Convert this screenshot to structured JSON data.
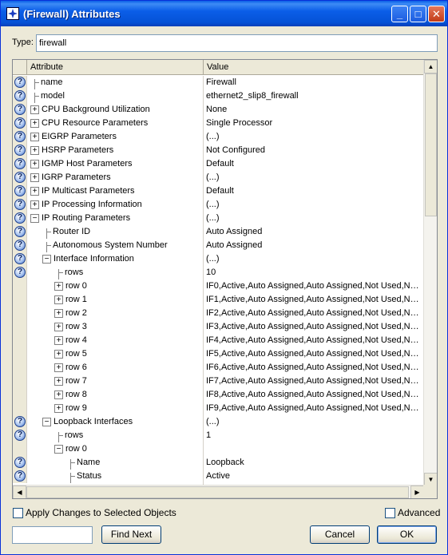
{
  "window": {
    "title": "(Firewall) Attributes"
  },
  "type_field": {
    "label": "Type:",
    "value": "firewall"
  },
  "grid": {
    "headers": {
      "attribute": "Attribute",
      "value": "Value"
    },
    "rows": [
      {
        "label": "name",
        "value": "Firewall",
        "help": true
      },
      {
        "label": "model",
        "value": "ethernet2_slip8_firewall",
        "help": true
      },
      {
        "label": "CPU Background Utilization",
        "value": "None",
        "help": true,
        "expander": "+"
      },
      {
        "label": "CPU Resource Parameters",
        "value": "Single Processor",
        "help": true,
        "expander": "+"
      },
      {
        "label": "EIGRP Parameters",
        "value": "(...)",
        "help": true,
        "expander": "+"
      },
      {
        "label": "HSRP Parameters",
        "value": "Not Configured",
        "help": true,
        "expander": "+"
      },
      {
        "label": "IGMP Host Parameters",
        "value": "Default",
        "help": true,
        "expander": "+"
      },
      {
        "label": "IGRP Parameters",
        "value": "(...)",
        "help": true,
        "expander": "+"
      },
      {
        "label": "IP Multicast Parameters",
        "value": "Default",
        "help": true,
        "expander": "+"
      },
      {
        "label": "IP Processing Information",
        "value": "(...)",
        "help": true,
        "expander": "+"
      },
      {
        "label": "IP Routing Parameters",
        "value": "(...)",
        "help": true,
        "expander": "−"
      },
      {
        "label": "Router ID",
        "value": "Auto Assigned",
        "help": true
      },
      {
        "label": "Autonomous System Number",
        "value": "Auto Assigned",
        "help": true
      },
      {
        "label": "Interface Information",
        "value": "(...)",
        "help": true,
        "expander": "−"
      },
      {
        "label": "rows",
        "value": "10",
        "help": true
      },
      {
        "label": "row 0",
        "value": "IF0,Active,Auto Assigned,Auto Assigned,Not Used,Non...",
        "help": false,
        "expander": "+"
      },
      {
        "label": "row 1",
        "value": "IF1,Active,Auto Assigned,Auto Assigned,Not Used,Non...",
        "help": false,
        "expander": "+"
      },
      {
        "label": "row 2",
        "value": "IF2,Active,Auto Assigned,Auto Assigned,Not Used,Non...",
        "help": false,
        "expander": "+"
      },
      {
        "label": "row 3",
        "value": "IF3,Active,Auto Assigned,Auto Assigned,Not Used,Non...",
        "help": false,
        "expander": "+"
      },
      {
        "label": "row 4",
        "value": "IF4,Active,Auto Assigned,Auto Assigned,Not Used,Non...",
        "help": false,
        "expander": "+"
      },
      {
        "label": "row 5",
        "value": "IF5,Active,Auto Assigned,Auto Assigned,Not Used,Non...",
        "help": false,
        "expander": "+"
      },
      {
        "label": "row 6",
        "value": "IF6,Active,Auto Assigned,Auto Assigned,Not Used,Non...",
        "help": false,
        "expander": "+"
      },
      {
        "label": "row 7",
        "value": "IF7,Active,Auto Assigned,Auto Assigned,Not Used,Non...",
        "help": false,
        "expander": "+"
      },
      {
        "label": "row 8",
        "value": "IF8,Active,Auto Assigned,Auto Assigned,Not Used,Non...",
        "help": false,
        "expander": "+"
      },
      {
        "label": "row 9",
        "value": "IF9,Active,Auto Assigned,Auto Assigned,Not Used,Non...",
        "help": false,
        "expander": "+"
      },
      {
        "label": "Loopback Interfaces",
        "value": "(...)",
        "help": true,
        "expander": "−"
      },
      {
        "label": "rows",
        "value": "1",
        "help": true
      },
      {
        "label": "row 0",
        "value": "",
        "help": false,
        "expander": "−"
      },
      {
        "label": "Name",
        "value": "Loopback",
        "help": true
      },
      {
        "label": "Status",
        "value": "Active",
        "help": true
      }
    ]
  },
  "footer": {
    "apply_changes_label": "Apply Changes to Selected Objects",
    "advanced_label": "Advanced",
    "find_value": "",
    "find_next_label": "Find Next",
    "cancel_label": "Cancel",
    "ok_label": "OK"
  },
  "icons": {
    "title": "app-star-icon",
    "help": "question-mark-icon",
    "expand": "plus-box-icon",
    "collapse": "minus-box-icon"
  },
  "colors": {
    "title_bar": "#0552d6",
    "dialog_bg": "#ece9d8",
    "grid_bg": "#ffffff"
  }
}
